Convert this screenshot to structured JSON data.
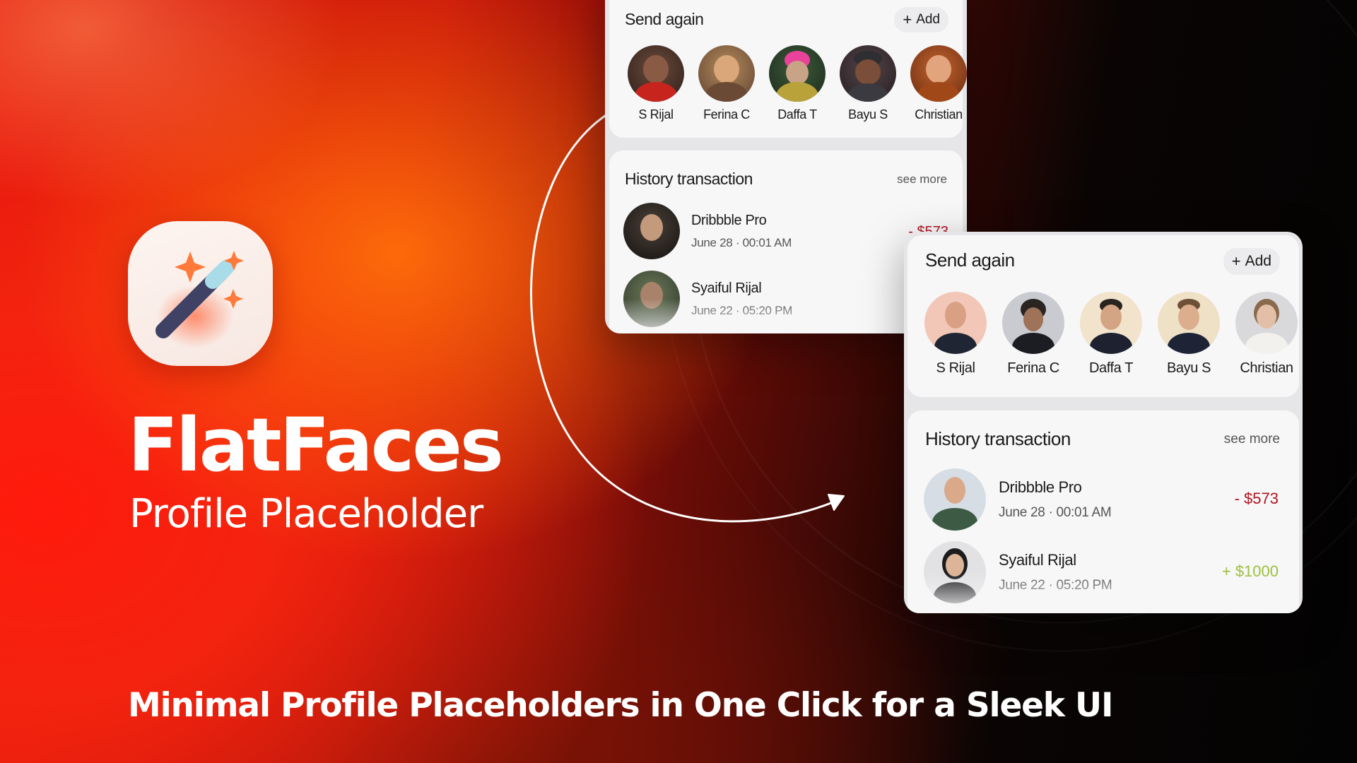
{
  "hero": {
    "title": "FlatFaces",
    "subtitle": "Profile Placeholder",
    "tagline": "Minimal Profile Placeholders in One Click for a Sleek UI"
  },
  "logo_icon": "magic-wand-icon",
  "colors": {
    "accent": "#ff3b12",
    "negative_amount": "#b3121f",
    "positive_amount": "#9bbf3c",
    "card_bg": "#f7f7f8"
  },
  "before_card": {
    "send_again": {
      "title": "Send again",
      "add_label": "Add",
      "contacts": [
        {
          "name": "S Rijal"
        },
        {
          "name": "Ferina C"
        },
        {
          "name": "Daffa T"
        },
        {
          "name": "Bayu S"
        },
        {
          "name": "Christian"
        }
      ]
    },
    "history": {
      "title": "History transaction",
      "see_more": "see more",
      "transactions": [
        {
          "name": "Dribbble Pro",
          "date": "June 28 · 00:01 AM",
          "amount": "- $573"
        },
        {
          "name": "Syaiful Rijal",
          "date": "June 22 · 05:20 PM",
          "amount": "+"
        }
      ]
    }
  },
  "after_card": {
    "send_again": {
      "title": "Send again",
      "add_label": "Add",
      "contacts": [
        {
          "name": "S Rijal"
        },
        {
          "name": "Ferina C"
        },
        {
          "name": "Daffa T"
        },
        {
          "name": "Bayu S"
        },
        {
          "name": "Christian"
        }
      ]
    },
    "history": {
      "title": "History transaction",
      "see_more": "see more",
      "transactions": [
        {
          "name": "Dribbble Pro",
          "date": "June 28 · 00:01 AM",
          "amount": "- $573"
        },
        {
          "name": "Syaiful Rijal",
          "date": "June 22 · 05:20 PM",
          "amount": "+ $1000"
        }
      ]
    }
  }
}
